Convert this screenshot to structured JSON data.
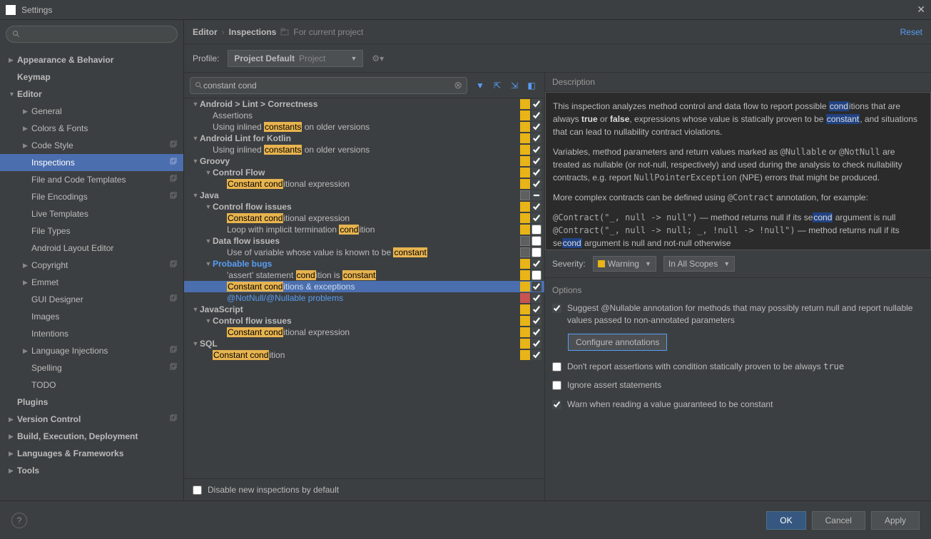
{
  "window": {
    "title": "Settings"
  },
  "sidebar": {
    "items": [
      {
        "label": "Appearance & Behavior",
        "arrow": "▶",
        "bold": true,
        "indent": 0
      },
      {
        "label": "Keymap",
        "arrow": "",
        "bold": true,
        "indent": 0
      },
      {
        "label": "Editor",
        "arrow": "▼",
        "bold": true,
        "indent": 0
      },
      {
        "label": "General",
        "arrow": "▶",
        "bold": false,
        "indent": 1
      },
      {
        "label": "Colors & Fonts",
        "arrow": "▶",
        "bold": false,
        "indent": 1
      },
      {
        "label": "Code Style",
        "arrow": "▶",
        "bold": false,
        "indent": 1,
        "copy": true
      },
      {
        "label": "Inspections",
        "arrow": "",
        "bold": false,
        "indent": 1,
        "copy": true,
        "selected": true
      },
      {
        "label": "File and Code Templates",
        "arrow": "",
        "bold": false,
        "indent": 1,
        "copy": true
      },
      {
        "label": "File Encodings",
        "arrow": "",
        "bold": false,
        "indent": 1,
        "copy": true
      },
      {
        "label": "Live Templates",
        "arrow": "",
        "bold": false,
        "indent": 1
      },
      {
        "label": "File Types",
        "arrow": "",
        "bold": false,
        "indent": 1
      },
      {
        "label": "Android Layout Editor",
        "arrow": "",
        "bold": false,
        "indent": 1
      },
      {
        "label": "Copyright",
        "arrow": "▶",
        "bold": false,
        "indent": 1,
        "copy": true
      },
      {
        "label": "Emmet",
        "arrow": "▶",
        "bold": false,
        "indent": 1
      },
      {
        "label": "GUI Designer",
        "arrow": "",
        "bold": false,
        "indent": 1,
        "copy": true
      },
      {
        "label": "Images",
        "arrow": "",
        "bold": false,
        "indent": 1
      },
      {
        "label": "Intentions",
        "arrow": "",
        "bold": false,
        "indent": 1
      },
      {
        "label": "Language Injections",
        "arrow": "▶",
        "bold": false,
        "indent": 1,
        "copy": true
      },
      {
        "label": "Spelling",
        "arrow": "",
        "bold": false,
        "indent": 1,
        "copy": true
      },
      {
        "label": "TODO",
        "arrow": "",
        "bold": false,
        "indent": 1
      },
      {
        "label": "Plugins",
        "arrow": "",
        "bold": true,
        "indent": 0
      },
      {
        "label": "Version Control",
        "arrow": "▶",
        "bold": true,
        "indent": 0,
        "copy": true
      },
      {
        "label": "Build, Execution, Deployment",
        "arrow": "▶",
        "bold": true,
        "indent": 0
      },
      {
        "label": "Languages & Frameworks",
        "arrow": "▶",
        "bold": true,
        "indent": 0
      },
      {
        "label": "Tools",
        "arrow": "▶",
        "bold": true,
        "indent": 0
      }
    ]
  },
  "header": {
    "crumb1": "Editor",
    "crumb2": "Inspections",
    "scope": "For current project",
    "reset": "Reset"
  },
  "profile": {
    "label": "Profile:",
    "value": "Project Default",
    "suffix": "Project"
  },
  "filter": {
    "value": "constant cond"
  },
  "inspections": [
    {
      "indent": 0,
      "arrow": "▼",
      "pre": "Android > Lint > Correctness",
      "hl": "",
      "post": "",
      "ind": "yellow",
      "checked": true,
      "bold": true
    },
    {
      "indent": 1,
      "arrow": "",
      "pre": "Assertions",
      "hl": "",
      "post": "",
      "ind": "yellow",
      "checked": true
    },
    {
      "indent": 1,
      "arrow": "",
      "pre": "Using inlined ",
      "hl": "constants",
      "post": " on older versions",
      "ind": "yellow",
      "checked": true
    },
    {
      "indent": 0,
      "arrow": "▼",
      "pre": "Android Lint for Kotlin",
      "hl": "",
      "post": "",
      "ind": "yellow",
      "checked": true,
      "bold": true
    },
    {
      "indent": 1,
      "arrow": "",
      "pre": "Using inlined ",
      "hl": "constants",
      "post": " on older versions",
      "ind": "yellow",
      "checked": true
    },
    {
      "indent": 0,
      "arrow": "▼",
      "pre": "Groovy",
      "hl": "",
      "post": "",
      "ind": "yellow",
      "checked": true,
      "bold": true
    },
    {
      "indent": 1,
      "arrow": "▼",
      "pre": "Control Flow",
      "hl": "",
      "post": "",
      "ind": "yellow",
      "checked": true,
      "bold": true
    },
    {
      "indent": 2,
      "arrow": "",
      "pre": "",
      "hl": "Constant cond",
      "post": "itional expression",
      "ind": "yellow",
      "checked": true
    },
    {
      "indent": 0,
      "arrow": "▼",
      "pre": "Java",
      "hl": "",
      "post": "",
      "ind": "gray",
      "checked": null,
      "bold": true
    },
    {
      "indent": 1,
      "arrow": "▼",
      "pre": "Control flow issues",
      "hl": "",
      "post": "",
      "ind": "yellow",
      "checked": true,
      "bold": true
    },
    {
      "indent": 2,
      "arrow": "",
      "pre": "",
      "hl": "Constant cond",
      "post": "itional expression",
      "ind": "yellow",
      "checked": true
    },
    {
      "indent": 2,
      "arrow": "",
      "pre": "Loop with implicit termination ",
      "hl": "cond",
      "post": "ition",
      "ind": "yellow",
      "checked": false
    },
    {
      "indent": 1,
      "arrow": "▼",
      "pre": "Data flow issues",
      "hl": "",
      "post": "",
      "ind": "gray",
      "checked": false,
      "bold": true
    },
    {
      "indent": 2,
      "arrow": "",
      "pre": "Use of variable whose value is known to be ",
      "hl": "constant",
      "post": "",
      "ind": "gray",
      "checked": false
    },
    {
      "indent": 1,
      "arrow": "▼",
      "pre": "Probable bugs",
      "hl": "",
      "post": "",
      "ind": "yellow",
      "checked": true,
      "bold": true,
      "link": true
    },
    {
      "indent": 2,
      "arrow": "",
      "pre": "'assert' statement ",
      "hl": "cond",
      "post": "ition is ",
      "hl2": "constant",
      "ind": "yellow",
      "checked": false
    },
    {
      "indent": 2,
      "arrow": "",
      "pre": "",
      "hl": "Constant cond",
      "post": "itions & exceptions",
      "ind": "yellow",
      "checked": true,
      "selected": true,
      "link": true
    },
    {
      "indent": 2,
      "arrow": "",
      "pre": "@NotNull/@Nullable problems",
      "hl": "",
      "post": "",
      "ind": "red",
      "checked": true,
      "link": true
    },
    {
      "indent": 0,
      "arrow": "▼",
      "pre": "JavaScript",
      "hl": "",
      "post": "",
      "ind": "yellow",
      "checked": true,
      "bold": true
    },
    {
      "indent": 1,
      "arrow": "▼",
      "pre": "Control flow issues",
      "hl": "",
      "post": "",
      "ind": "yellow",
      "checked": true,
      "bold": true
    },
    {
      "indent": 2,
      "arrow": "",
      "pre": "",
      "hl": "Constant cond",
      "post": "itional expression",
      "ind": "yellow",
      "checked": true
    },
    {
      "indent": 0,
      "arrow": "▼",
      "pre": "SQL",
      "hl": "",
      "post": "",
      "ind": "yellow",
      "checked": true,
      "bold": true
    },
    {
      "indent": 1,
      "arrow": "",
      "pre": "",
      "hl": "Constant cond",
      "post": "ition",
      "ind": "yellow",
      "checked": true
    }
  ],
  "disable": {
    "label": "Disable new inspections by default"
  },
  "description": {
    "title": "Description",
    "p1a": "This inspection analyzes method control and data flow to report possible ",
    "p1hl1": "cond",
    "p1b": "itions that are always ",
    "p1true": "true",
    "p1c": " or ",
    "p1false": "false",
    "p1d": ", expressions whose value is statically proven to be ",
    "p1hl2": "constant",
    "p1e": ", and situations that can lead to nullability contract violations.",
    "p2a": "Variables, method parameters and return values marked as ",
    "p2c1": "@Nullable",
    "p2b": " or ",
    "p2c2": "@NotNull",
    "p2c": " are treated as nullable (or not-null, respectively) and used during the analysis to check nullability contracts, e.g. report ",
    "p2c3": "NullPointerException",
    "p2d": " (NPE) errors that might be produced.",
    "p3a": "More complex contracts can be defined using ",
    "p3c1": "@Contract",
    "p3b": " annotation, for example:",
    "p4a": "@Contract(\"_, null -> null\")",
    "p4b": " — method returns null if its se",
    "p4hl": "cond",
    "p4c": " argument is null",
    "p5a": "@Contract(\"_, null -> null; _, !null -> !null\")",
    "p5b": " — method returns null if its se",
    "p5hl": "cond",
    "p5c": " argument is null and not-null otherwise"
  },
  "severity": {
    "label": "Severity:",
    "value": "Warning",
    "scope": "In All Scopes"
  },
  "options": {
    "title": "Options",
    "opt1": "Suggest @Nullable annotation for methods that may possibly return null and report nullable values passed to non-annotated parameters",
    "configure": "Configure annotations",
    "opt2a": "Don't report assertions with condition statically proven to be always ",
    "opt2b": "true",
    "opt3": "Ignore assert statements",
    "opt4": "Warn when reading a value guaranteed to be constant"
  },
  "footer": {
    "ok": "OK",
    "cancel": "Cancel",
    "apply": "Apply"
  }
}
